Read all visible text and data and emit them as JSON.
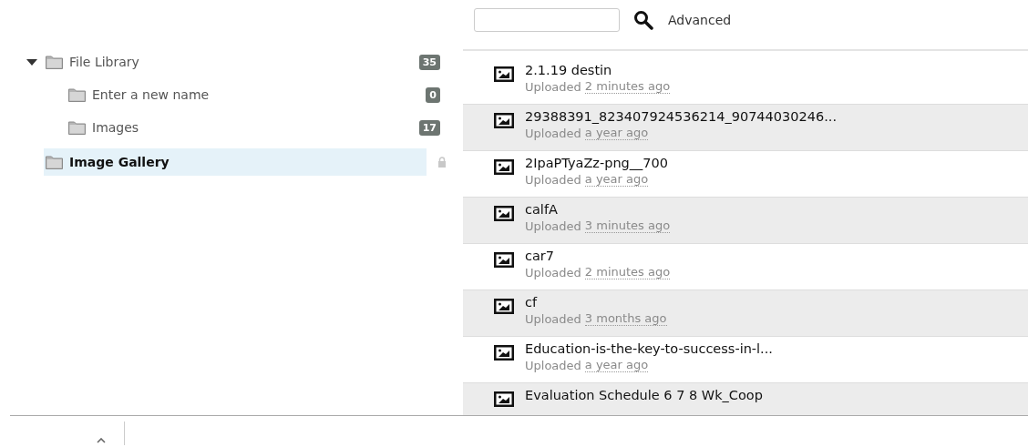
{
  "tree": [
    {
      "label": "File Library",
      "count": "35",
      "expanded": true,
      "selected": false,
      "locked": false,
      "children": [
        {
          "label": "Enter a new name",
          "count": "0",
          "selected": false,
          "locked": false
        },
        {
          "label": "Images",
          "count": "17",
          "selected": false,
          "locked": false
        }
      ]
    },
    {
      "label": "Image Gallery",
      "selected": true,
      "locked": true
    }
  ],
  "search": {
    "action": "Advanced"
  },
  "files": [
    {
      "name": "2.1.19 destin",
      "prefix": "Uploaded",
      "time": "2 minutes ago"
    },
    {
      "name": "29388391_823407924536214_90744030246...",
      "prefix": "Uploaded",
      "time": "a year ago"
    },
    {
      "name": "2IpaPTyaZz-png__700",
      "prefix": "Uploaded",
      "time": "a year ago"
    },
    {
      "name": "calfA",
      "prefix": "Uploaded",
      "time": "3 minutes ago"
    },
    {
      "name": "car7",
      "prefix": "Uploaded",
      "time": "2 minutes ago"
    },
    {
      "name": "cf",
      "prefix": "Uploaded",
      "time": "3 months ago"
    },
    {
      "name": "Education-is-the-key-to-success-in-l...",
      "prefix": "Uploaded",
      "time": "a year ago"
    },
    {
      "name": "Evaluation Schedule 6 7 8 Wk_Coop"
    }
  ]
}
